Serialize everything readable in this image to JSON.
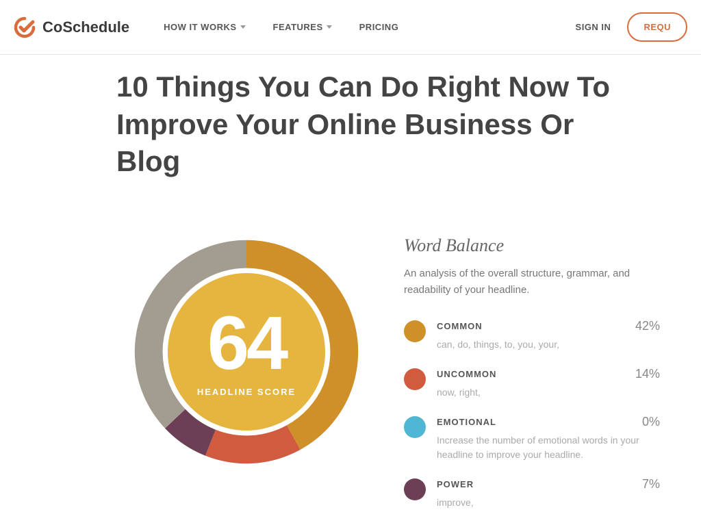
{
  "brand": "CoSchedule",
  "nav": {
    "items": [
      {
        "label": "HOW IT WORKS",
        "dropdown": true
      },
      {
        "label": "FEATURES",
        "dropdown": true
      },
      {
        "label": "PRICING",
        "dropdown": false
      }
    ],
    "sign_in": "SIGN IN",
    "cta": "REQU"
  },
  "headline": "10 Things You Can Do Right Now To Improve Your Online Business Or Blog",
  "score": {
    "value": "64",
    "label": "HEADLINE SCORE"
  },
  "word_balance": {
    "title": "Word Balance",
    "description": "An analysis of the overall structure, grammar, and readability of your headline.",
    "items": [
      {
        "label": "COMMON",
        "pct": "42%",
        "detail": "can, do, things, to, you, your,",
        "color": "#cf8f29"
      },
      {
        "label": "UNCOMMON",
        "pct": "14%",
        "detail": "now, right,",
        "color": "#d15b3e"
      },
      {
        "label": "EMOTIONAL",
        "pct": "0%",
        "detail": "Increase the number of emotional words in your headline to improve your headline.",
        "color": "#4fb7d4"
      },
      {
        "label": "POWER",
        "pct": "7%",
        "detail": "improve,",
        "color": "#6d3f56"
      }
    ]
  },
  "chart_data": {
    "type": "pie",
    "title": "Headline Score",
    "series": [
      {
        "name": "Common",
        "value": 42,
        "color": "#cf8f29"
      },
      {
        "name": "Uncommon",
        "value": 14,
        "color": "#d15b3e"
      },
      {
        "name": "Emotional",
        "value": 0,
        "color": "#4fb7d4"
      },
      {
        "name": "Power",
        "value": 7,
        "color": "#6d3f56"
      },
      {
        "name": "Remaining",
        "value": 37,
        "color": "#a39c90"
      }
    ],
    "center_value": 64,
    "center_label": "HEADLINE SCORE"
  }
}
